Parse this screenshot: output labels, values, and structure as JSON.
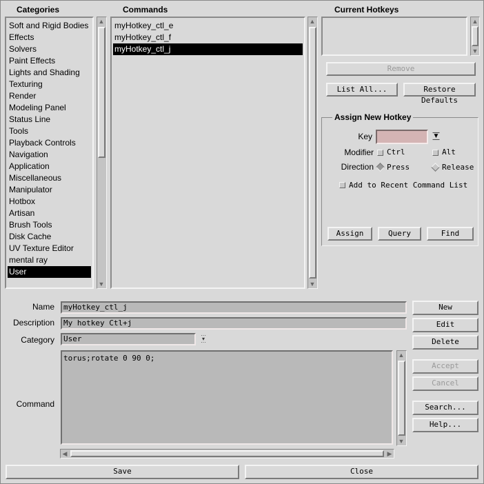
{
  "categories": {
    "header": "Categories",
    "selected": "User",
    "items": [
      "Soft and Rigid Bodies",
      "Effects",
      "Solvers",
      "Paint Effects",
      "Lights and Shading",
      "Texturing",
      "Render",
      "Modeling Panel",
      "Status Line",
      "Tools",
      "Playback Controls",
      "Navigation",
      "Application",
      "Miscellaneous",
      "Manipulator",
      "Hotbox",
      "Artisan",
      "Brush Tools",
      "Disk Cache",
      "UV Texture Editor",
      "mental ray",
      "User"
    ]
  },
  "commands": {
    "header": "Commands",
    "selected": "myHotkey_ctl_j",
    "items": [
      "myHotkey_ctl_e",
      "myHotkey_ctl_f",
      "myHotkey_ctl_j"
    ]
  },
  "current_hotkeys": {
    "header": "Current Hotkeys",
    "remove": "Remove",
    "list_all": "List All...",
    "restore_defaults": "Restore Defaults"
  },
  "assign": {
    "title": "Assign New Hotkey",
    "key_label": "Key",
    "key_value": "",
    "modifier_label": "Modifier",
    "ctrl": "Ctrl",
    "alt": "Alt",
    "ctrl_checked": false,
    "alt_checked": false,
    "direction_label": "Direction",
    "press": "Press",
    "release": "Release",
    "direction_value": "Press",
    "recent": "Add to Recent Command List",
    "recent_checked": false,
    "assign_btn": "Assign",
    "query_btn": "Query",
    "find_btn": "Find"
  },
  "editor": {
    "name_label": "Name",
    "name_value": "myHotkey_ctl_j",
    "description_label": "Description",
    "description_value": "My hotkey Ctl+j",
    "category_label": "Category",
    "category_value": "User",
    "command_label": "Command",
    "command_value": "torus;rotate 0 90 0;"
  },
  "side_buttons": {
    "new": "New",
    "edit": "Edit",
    "delete": "Delete",
    "accept": "Accept",
    "cancel": "Cancel",
    "search": "Search...",
    "help": "Help..."
  },
  "bottom": {
    "save": "Save",
    "close": "Close"
  },
  "colors": {
    "background": "#d9d9d9",
    "field": "#b9b9b9",
    "key_field": "#d4b4b4",
    "selection": "#000000"
  }
}
